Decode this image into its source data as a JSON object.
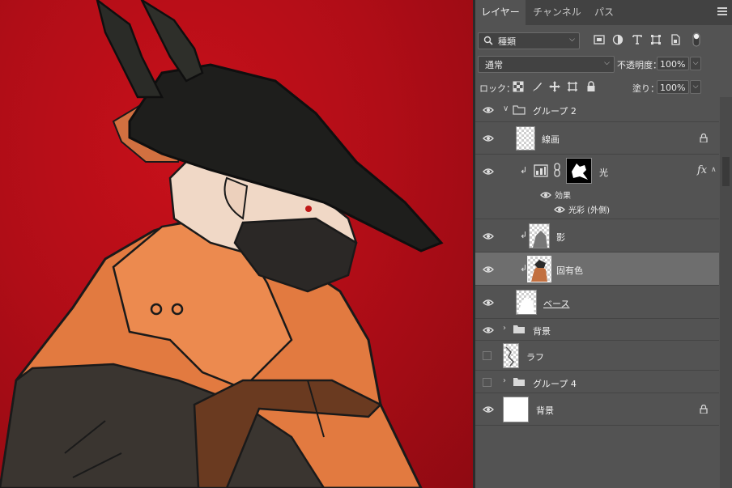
{
  "tabs": [
    {
      "label": "レイヤー",
      "active": true
    },
    {
      "label": "チャンネル",
      "active": false
    },
    {
      "label": "パス",
      "active": false
    }
  ],
  "filter": {
    "kind_label": "種類"
  },
  "blend_mode": {
    "value": "通常"
  },
  "opacity": {
    "label": "不透明度：",
    "value": "100%"
  },
  "lock": {
    "label": "ロック："
  },
  "fill": {
    "label": "塗り：",
    "value": "100%"
  },
  "layers": [
    {
      "name": "グループ 2",
      "type": "group",
      "expanded": true,
      "visible": true
    },
    {
      "name": "線画",
      "type": "pixel",
      "locked": true,
      "visible": true
    },
    {
      "name": "光",
      "type": "adjustment",
      "clipped": true,
      "has_fx": true,
      "fx_label": "fx",
      "visible": true,
      "effects_label": "効果",
      "effects": [
        "光彩 (外側)"
      ]
    },
    {
      "name": "影",
      "type": "pixel",
      "clipped": true,
      "visible": true
    },
    {
      "name": "固有色",
      "type": "pixel",
      "clipped": true,
      "selected": true,
      "visible": true
    },
    {
      "name": "ベース",
      "type": "pixel",
      "visible": true
    },
    {
      "name": "背景",
      "type": "group",
      "expanded": false,
      "visible": true
    },
    {
      "name": "ラフ",
      "type": "pixel",
      "visible": false
    },
    {
      "name": "グループ 4",
      "type": "group",
      "expanded": false,
      "visible": false
    },
    {
      "name": "背景",
      "type": "background",
      "locked": true,
      "visible": true
    }
  ],
  "colors": {
    "canvas_bg": "#b00d17",
    "coat": "#e0783f",
    "hat": "#1e1e1c"
  }
}
